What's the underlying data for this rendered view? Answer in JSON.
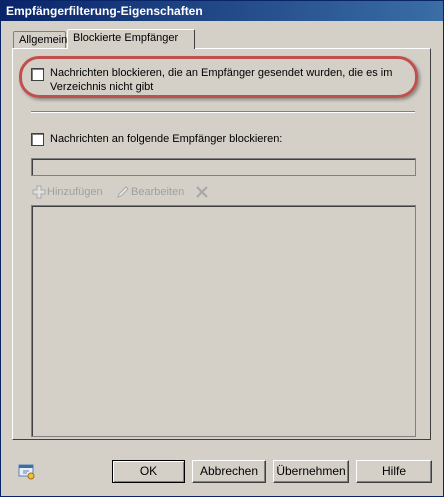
{
  "window": {
    "title": "Empfängerfilterung-Eigenschaften"
  },
  "tabs": [
    {
      "label": "Allgemein",
      "active": false
    },
    {
      "label": "Blockierte Empfänger",
      "active": true
    }
  ],
  "options": {
    "block_nonexistent": {
      "line1": "Nachrichten blockieren, die an Empfänger gesendet wurden, die es im",
      "line2": "Verzeichnis nicht gibt",
      "checked": false
    },
    "block_listed": {
      "label": "Nachrichten an folgende Empfänger blockieren:",
      "checked": false
    }
  },
  "recipient_input": {
    "value": ""
  },
  "toolbar": {
    "add_label": "Hinzufügen",
    "edit_label": "Bearbeiten"
  },
  "buttons": {
    "ok": "OK",
    "cancel": "Abbrechen",
    "apply": "Übernehmen",
    "help": "Hilfe"
  },
  "colors": {
    "highlight": "#c0504d",
    "titlebar": "#0a246a"
  }
}
